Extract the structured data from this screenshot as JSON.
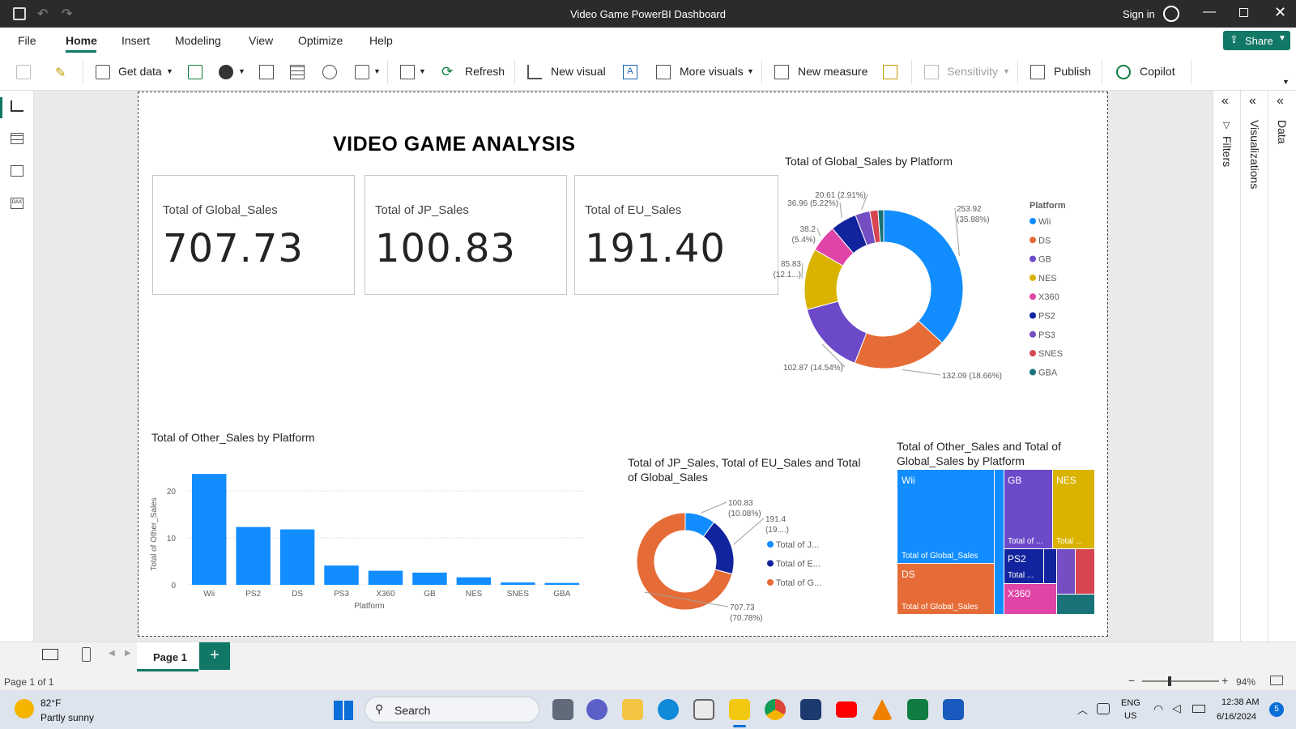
{
  "window": {
    "title": "Video Game PowerBI Dashboard",
    "sign_in": "Sign in"
  },
  "menu": [
    "File",
    "Home",
    "Insert",
    "Modeling",
    "View",
    "Optimize",
    "Help"
  ],
  "share": "Share",
  "ribbon": {
    "get_data": "Get data",
    "refresh": "Refresh",
    "new_visual": "New visual",
    "more_visuals": "More visuals",
    "new_measure": "New measure",
    "sensitivity": "Sensitivity",
    "publish": "Publish",
    "copilot": "Copilot"
  },
  "panes": {
    "filters": "Filters",
    "visualizations": "Visualizations",
    "data": "Data"
  },
  "dashboard": {
    "title": "VIDEO GAME ANALYSIS"
  },
  "cards": [
    {
      "label": "Total of Global_Sales",
      "value": "707.73"
    },
    {
      "label": "Total of JP_Sales",
      "value": "100.83"
    },
    {
      "label": "Total of EU_Sales",
      "value": "191.40"
    }
  ],
  "chart_data": [
    {
      "type": "pie",
      "title": "Total of Global_Sales by Platform",
      "legend_title": "Platform",
      "legend_position": "right",
      "categories": [
        "Wii",
        "DS",
        "GB",
        "NES",
        "X360",
        "PS2",
        "PS3",
        "SNES",
        "GBA"
      ],
      "values": [
        253.92,
        132.09,
        102.87,
        85.83,
        38.2,
        36.96,
        20.61,
        11.5,
        8.0
      ],
      "data_labels": [
        "253.92 (35.88%)",
        "132.09 (18.66%)",
        "102.87 (14.54%)",
        "85.83 (12.1...)",
        "38.2 (5.4%)",
        "36.96 (5.22%)",
        "20.61 (2.91%)",
        "",
        ""
      ],
      "colors": [
        "#118DFF",
        "#E66C37",
        "#6B49C8",
        "#D9B300",
        "#E044A7",
        "#12239E",
        "#744EC2",
        "#D64550",
        "#197278"
      ]
    },
    {
      "type": "bar",
      "title": "Total of Other_Sales by Platform",
      "xlabel": "Platform",
      "ylabel": "Total of Other_Sales",
      "categories": [
        "Wii",
        "PS2",
        "DS",
        "PS3",
        "X360",
        "GB",
        "NES",
        "SNES",
        "GBA"
      ],
      "values": [
        23.6,
        12.3,
        11.8,
        4.1,
        3.0,
        2.6,
        1.6,
        0.5,
        0.4
      ],
      "yticks": [
        "0",
        "10",
        "20"
      ],
      "ylim": [
        0,
        25
      ],
      "color": "#118DFF"
    },
    {
      "type": "pie",
      "title": "Total of JP_Sales, Total of EU_Sales and Total of Global_Sales",
      "categories": [
        "Total of J...",
        "Total of E...",
        "Total of G..."
      ],
      "values": [
        100.83,
        191.4,
        707.73
      ],
      "data_labels": [
        "100.83 (10.08%)",
        "191.4 (19....)",
        "707.73 (70.78%)"
      ],
      "colors": [
        "#118DFF",
        "#12239E",
        "#E66C37"
      ]
    },
    {
      "type": "table",
      "title": "Total of Other_Sales and Total of Global_Sales by Platform",
      "tiles": [
        {
          "name": "Wii",
          "sub": "Total of Global_Sales",
          "color": "#118DFF"
        },
        {
          "name": "DS",
          "sub": "Total of Global_Sales",
          "color": "#E66C37"
        },
        {
          "name": "GB",
          "sub": "Total of ...",
          "color": "#6B49C8"
        },
        {
          "name": "NES",
          "sub": "Total ...",
          "color": "#D9B300"
        },
        {
          "name": "PS2",
          "sub": "Total ...",
          "color": "#12239E"
        },
        {
          "name": "X360",
          "sub": "",
          "color": "#E044A7"
        }
      ]
    }
  ],
  "tabs": {
    "page": "Page 1",
    "add": "+"
  },
  "status": {
    "page": "Page 1 of 1",
    "zoom": "94%"
  },
  "taskbar": {
    "temp": "82°F",
    "weather": "Partly sunny",
    "search": "Search",
    "lang1": "ENG",
    "lang2": "US",
    "time": "12:38 AM",
    "date": "6/16/2024",
    "badge": "5"
  }
}
